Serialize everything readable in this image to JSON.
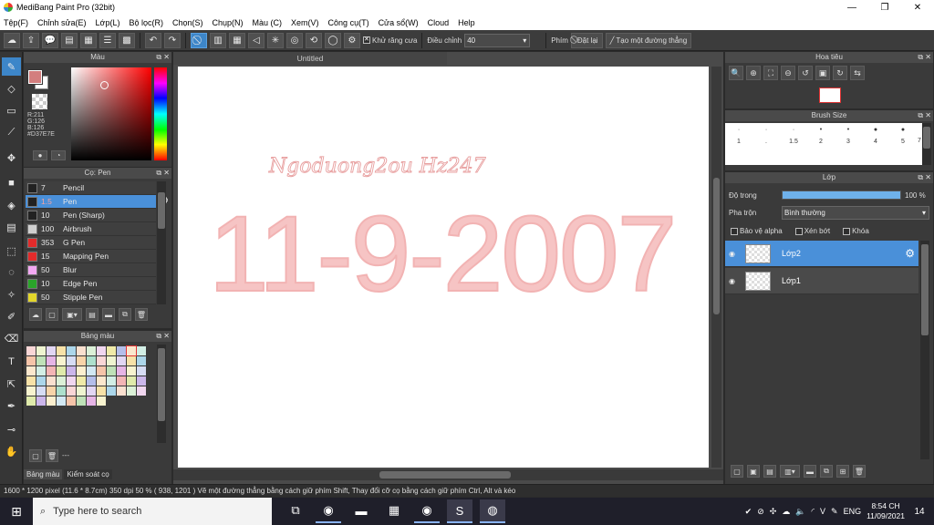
{
  "window": {
    "title": "MediBang Paint Pro (32bit)",
    "controls": [
      "—",
      "❐",
      "✕"
    ]
  },
  "menu": [
    "Tệp(F)",
    "Chỉnh sửa(E)",
    "Lớp(L)",
    "Bộ lọc(R)",
    "Chọn(S)",
    "Chụp(N)",
    "Màu (C)",
    "Xem(V)",
    "Công cụ(T)",
    "Cửa sổ(W)",
    "Cloud",
    "Help"
  ],
  "toolbar": {
    "antialias_label": "Khử răng cưa",
    "adjust_label": "Điều chỉnh",
    "adjust_value": "40",
    "key_label": "Phím",
    "reset_label": "Đặt lại",
    "make_line_label": "Tạo một đường thẳng"
  },
  "color_panel": {
    "title": "Màu",
    "r": "R:211",
    "g": "G:126",
    "b": "B:126",
    "hex": "#D37E7E",
    "current_color": "#D37E7E"
  },
  "brush_panel": {
    "title": "Cọ: Pen",
    "items": [
      {
        "size": "7",
        "name": "Pencil",
        "color": "#222222"
      },
      {
        "size": "1.5",
        "name": "Pen",
        "color": "#222222",
        "selected": true
      },
      {
        "size": "10",
        "name": "Pen (Sharp)",
        "color": "#222222"
      },
      {
        "size": "100",
        "name": "Airbrush",
        "color": "#cfcfcf"
      },
      {
        "size": "353",
        "name": "G Pen",
        "color": "#e22b2b"
      },
      {
        "size": "15",
        "name": "Mapping Pen",
        "color": "#e22b2b"
      },
      {
        "size": "50",
        "name": "Blur",
        "color": "#f2a8f2"
      },
      {
        "size": "10",
        "name": "Edge Pen",
        "color": "#2aa52a"
      },
      {
        "size": "50",
        "name": "Stipple Pen",
        "color": "#e3d62b"
      }
    ]
  },
  "palette_panel": {
    "title": "Bảng màu",
    "footer_text": "---",
    "tab_palette": "Bảng màu",
    "tab_control": "Kiểm soát cọ"
  },
  "document": {
    "tab_title": "Untitled",
    "handwriting": "Ngoduong2ou Hz247",
    "big_text": "11-9-2007"
  },
  "navigator": {
    "title": "Hoa tiêu"
  },
  "brush_size": {
    "title": "Brush Size",
    "sizes": [
      "1",
      ".",
      "1.5",
      "2",
      "3",
      "4",
      "5",
      "7"
    ]
  },
  "layer_panel": {
    "title": "Lớp",
    "opacity_label": "Độ trong",
    "opacity_value": "100 %",
    "opacity_fraction": 1.0,
    "blend_label": "Pha trộn",
    "blend_value": "Bình thường",
    "protect_alpha": "Bảo vệ alpha",
    "clipping": "Xén bớt",
    "lock": "Khóa",
    "layers": [
      {
        "name": "Lớp2",
        "selected": true
      },
      {
        "name": "Lớp1",
        "selected": false
      }
    ]
  },
  "status": {
    "size": "1600 * 1200 pixel",
    "cm": "(11.6 * 8.7cm)",
    "dpi": "350 dpi",
    "zoom": "50 %",
    "coords": "( 938, 1201 )",
    "hint": "Vẽ một đường thẳng bằng cách giữ phím Shift, Thay đổi cỡ cọ bằng cách giữ phím Ctrl, Alt và kéo"
  },
  "taskbar": {
    "search_placeholder": "Type here to search",
    "lang": "ENG",
    "time": "8:54 CH",
    "date": "11/09/2021",
    "notifications": "14"
  }
}
